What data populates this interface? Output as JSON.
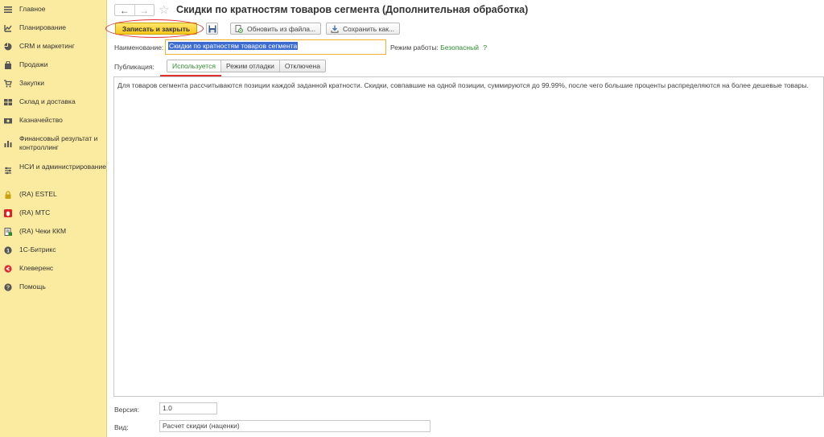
{
  "sidebar": {
    "items": [
      {
        "label": "Главное",
        "icon": "menu-icon"
      },
      {
        "label": "Планирование",
        "icon": "planning-icon"
      },
      {
        "label": "CRM и маркетинг",
        "icon": "pie-chart-icon"
      },
      {
        "label": "Продажи",
        "icon": "bag-icon"
      },
      {
        "label": "Закупки",
        "icon": "cart-icon"
      },
      {
        "label": "Склад и доставка",
        "icon": "warehouse-icon"
      },
      {
        "label": "Казначейство",
        "icon": "treasury-icon"
      },
      {
        "label": "Финансовый результат и контроллинг",
        "icon": "finance-chart-icon"
      },
      {
        "label": "НСИ и администрирование",
        "icon": "settings-icon"
      },
      {
        "label": "(RA) ESTEL",
        "icon": "lock-icon"
      },
      {
        "label": "(RA) МТС",
        "icon": "mts-icon"
      },
      {
        "label": "(RA) Чеки ККМ",
        "icon": "receipt-icon"
      },
      {
        "label": "1С-Битрикс",
        "icon": "bitrix-icon"
      },
      {
        "label": "Клеверенс",
        "icon": "cleverence-icon"
      },
      {
        "label": "Помощь",
        "icon": "help-icon"
      }
    ]
  },
  "header": {
    "back": "←",
    "forward": "→",
    "title": "Скидки по кратностям товаров сегмента (Дополнительная обработка)"
  },
  "toolbar": {
    "save_close_label": "Записать и закрыть",
    "update_label": "Обновить из файла...",
    "save_as_label": "Сохранить как..."
  },
  "form": {
    "name_label": "Наименование:",
    "name_value": "Скидки по кратностям товаров сегмента",
    "mode_label": "Режим работы:",
    "mode_value": "Безопасный",
    "mode_help": "?",
    "publication_label": "Публикация:",
    "publication_options": [
      "Используется",
      "Режим отладки",
      "Отключена"
    ],
    "description": "Для товаров сегмента рассчитываются позиции каждой заданной кратности. Скидки, совпавшие на одной позиции, суммируются до 99.99%, после чего большие проценты распределяются на более дешевые товары.",
    "version_label": "Версия:",
    "version_value": "1.0",
    "kind_label": "Вид:",
    "kind_value": "Расчет скидки (наценки)"
  },
  "colors": {
    "sidebar_bg": "#fbeba0",
    "primary_button": "#f7c81b",
    "accent_green": "#2c8a2c",
    "highlight_red": "#e03030",
    "selection_blue": "#3b6bd1"
  }
}
